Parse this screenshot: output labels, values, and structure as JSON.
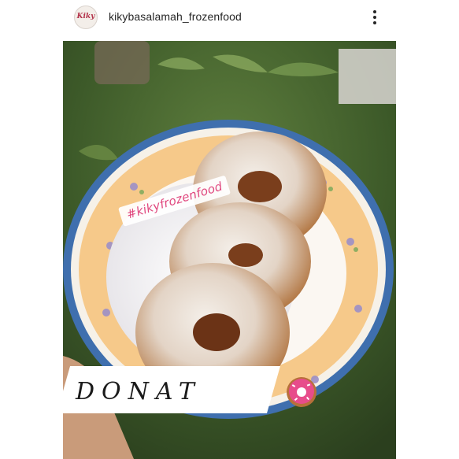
{
  "post": {
    "username": "kikybasalamah_frozenfood",
    "avatar_text": "Kiky",
    "more_icon": "more-vertical-icon",
    "hashtag": "#kikyfrozenfood",
    "caption": "DONAT",
    "caption_emoji": "donut-icon"
  },
  "colors": {
    "plate_rim": "#f6c98a",
    "plate_border": "#3f6fae",
    "donut": "#b7703a",
    "hashtag": "#e0477e"
  }
}
